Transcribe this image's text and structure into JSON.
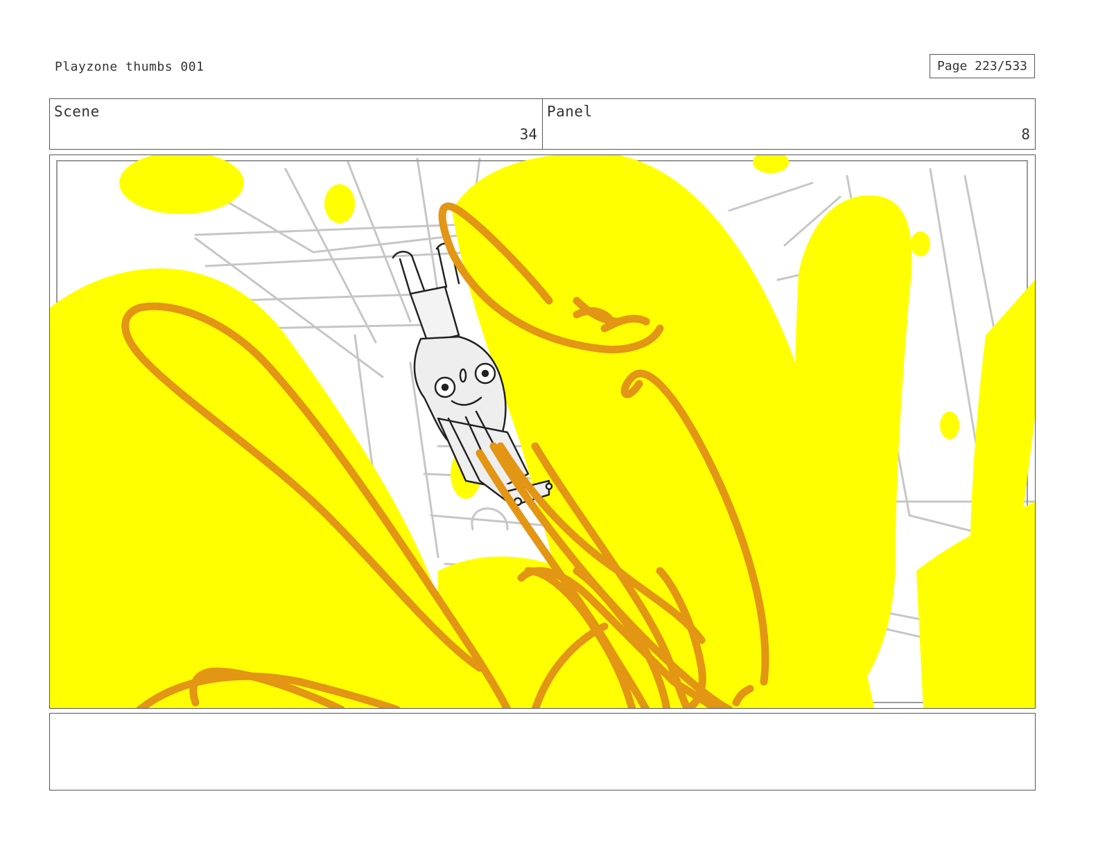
{
  "header": {
    "title": "Playzone thumbs 001",
    "page": "Page 223/533"
  },
  "info": {
    "scene_label": "Scene",
    "scene_value": "34",
    "panel_label": "Panel",
    "panel_value": "8"
  },
  "notes": {
    "text": ""
  },
  "colors": {
    "slime_yellow": "#ffff00",
    "slime_orange": "#e39514",
    "sketch_gray": "#c6c6c6",
    "ink": "#222222"
  },
  "artwork": {
    "icon": "storyboard-sketch-panel"
  }
}
